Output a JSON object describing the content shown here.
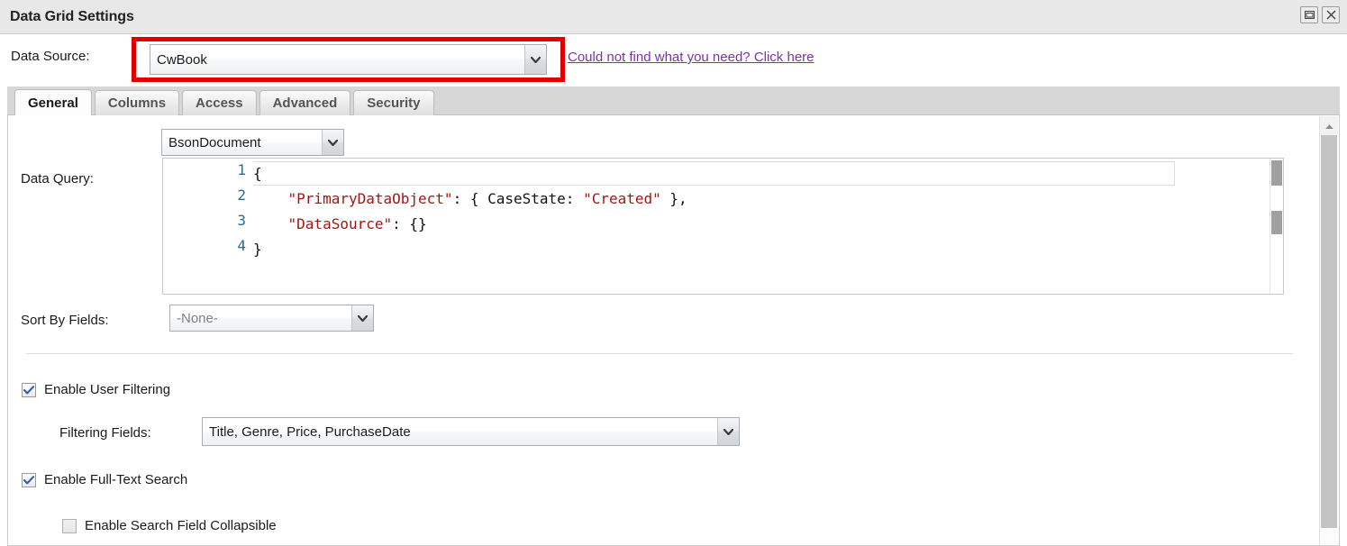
{
  "window": {
    "title": "Data Grid Settings",
    "restore_icon": "restore-icon",
    "close_icon": "close-icon"
  },
  "data_source": {
    "label": "Data Source:",
    "value": "CwBook",
    "link_text": "Could not find what you need? Click here",
    "link_color": "#7c33a8",
    "highlight_color": "#e00000"
  },
  "tabs": [
    {
      "label": "General",
      "active": true
    },
    {
      "label": "Columns",
      "active": false
    },
    {
      "label": "Access",
      "active": false
    },
    {
      "label": "Advanced",
      "active": false
    },
    {
      "label": "Security",
      "active": false
    }
  ],
  "general": {
    "type_select": {
      "value": "BsonDocument"
    },
    "data_query": {
      "label": "Data Query:",
      "tool_icon": "magnifier-plus-icon",
      "line_numbers": [
        "1",
        "2",
        "3",
        "4"
      ],
      "lines": [
        [
          {
            "t": "{",
            "c": "plain"
          }
        ],
        [
          {
            "t": "    ",
            "c": "plain"
          },
          {
            "t": "\"PrimaryDataObject\"",
            "c": "key"
          },
          {
            "t": ": { CaseState: ",
            "c": "plain"
          },
          {
            "t": "\"Created\"",
            "c": "str"
          },
          {
            "t": " },",
            "c": "plain"
          }
        ],
        [
          {
            "t": "    ",
            "c": "plain"
          },
          {
            "t": "\"DataSource\"",
            "c": "key"
          },
          {
            "t": ": {}",
            "c": "plain"
          }
        ],
        [
          {
            "t": "}",
            "c": "plain"
          }
        ]
      ]
    },
    "sort_by": {
      "label": "Sort By Fields:",
      "value": "-None-",
      "muted": true
    },
    "enable_user_filtering": {
      "label": "Enable User Filtering",
      "checked": true
    },
    "filtering_fields": {
      "label": "Filtering Fields:",
      "value": "Title, Genre, Price, PurchaseDate"
    },
    "enable_full_text_search": {
      "label": "Enable Full-Text Search",
      "checked": true
    },
    "enable_search_field_collapsible": {
      "label": "Enable Search Field Collapsible",
      "checked": false
    }
  },
  "scrollbar": {
    "up_arrow_icon": "chevron-up-icon"
  }
}
